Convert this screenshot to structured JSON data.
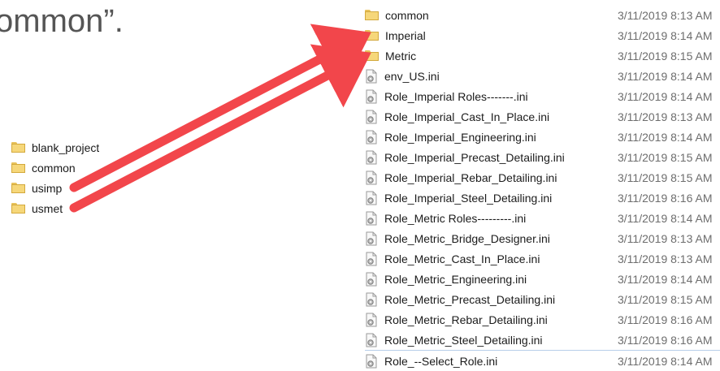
{
  "heading": {
    "text": "ommon”."
  },
  "left_folders": [
    {
      "name": "blank_project"
    },
    {
      "name": "common"
    },
    {
      "name": "usimp"
    },
    {
      "name": "usmet"
    }
  ],
  "right_files": [
    {
      "name": "common",
      "date": "3/11/2019 8:13 AM",
      "type": "folder"
    },
    {
      "name": "Imperial",
      "date": "3/11/2019 8:14 AM",
      "type": "folder"
    },
    {
      "name": "Metric",
      "date": "3/11/2019 8:15 AM",
      "type": "folder"
    },
    {
      "name": "env_US.ini",
      "date": "3/11/2019 8:14 AM",
      "type": "ini"
    },
    {
      "name": "Role_Imperial Roles-------.ini",
      "date": "3/11/2019 8:14 AM",
      "type": "ini"
    },
    {
      "name": "Role_Imperial_Cast_In_Place.ini",
      "date": "3/11/2019 8:13 AM",
      "type": "ini"
    },
    {
      "name": "Role_Imperial_Engineering.ini",
      "date": "3/11/2019 8:14 AM",
      "type": "ini"
    },
    {
      "name": "Role_Imperial_Precast_Detailing.ini",
      "date": "3/11/2019 8:15 AM",
      "type": "ini"
    },
    {
      "name": "Role_Imperial_Rebar_Detailing.ini",
      "date": "3/11/2019 8:15 AM",
      "type": "ini"
    },
    {
      "name": "Role_Imperial_Steel_Detailing.ini",
      "date": "3/11/2019 8:16 AM",
      "type": "ini"
    },
    {
      "name": "Role_Metric Roles---------.ini",
      "date": "3/11/2019 8:14 AM",
      "type": "ini"
    },
    {
      "name": "Role_Metric_Bridge_Designer.ini",
      "date": "3/11/2019 8:13 AM",
      "type": "ini"
    },
    {
      "name": "Role_Metric_Cast_In_Place.ini",
      "date": "3/11/2019 8:13 AM",
      "type": "ini"
    },
    {
      "name": "Role_Metric_Engineering.ini",
      "date": "3/11/2019 8:14 AM",
      "type": "ini"
    },
    {
      "name": "Role_Metric_Precast_Detailing.ini",
      "date": "3/11/2019 8:15 AM",
      "type": "ini"
    },
    {
      "name": "Role_Metric_Rebar_Detailing.ini",
      "date": "3/11/2019 8:16 AM",
      "type": "ini"
    },
    {
      "name": "Role_Metric_Steel_Detailing.ini",
      "date": "3/11/2019 8:16 AM",
      "type": "ini"
    },
    {
      "name": "Role_--Select_Role.ini",
      "date": "3/11/2019 8:14 AM",
      "type": "ini"
    }
  ],
  "colors": {
    "arrow": "#f2464b",
    "folder": "#f6d77a",
    "text": "#1b1b1b",
    "date": "#6d6d6d"
  },
  "icons": {
    "folder": "folder-icon",
    "ini": "settings-file-icon",
    "arrow": "arrow-icon"
  }
}
